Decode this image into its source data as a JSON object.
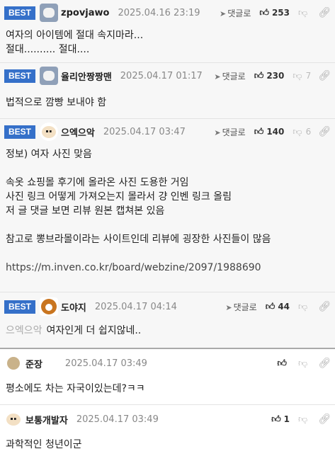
{
  "comments": [
    {
      "best": "BEST",
      "nick": "zpovjawo",
      "date": "2025.04.16 23:19",
      "reply": "댓글로",
      "up": "253",
      "down": "",
      "lines": [
        "여자의 아이템에 절대 속지마라...",
        "절대.......... 절대...."
      ]
    },
    {
      "best": "BEST",
      "nick": "율리안짱짱맨",
      "date": "2025.04.17 01:17",
      "reply": "댓글로",
      "up": "230",
      "down": "7",
      "lines": [
        "법적으로 깜빵 보내야 함"
      ]
    },
    {
      "best": "BEST",
      "nick": "으엑으악",
      "date": "2025.04.17 03:47",
      "reply": "댓글로",
      "up": "140",
      "down": "6",
      "lines": [
        "정보) 여자 사진 맞음",
        "",
        "속옷 쇼핑몰 후기에 올라온 사진 도용한 거임",
        "사진 링크 어떻게 가져오는지 몰라서 걍 인벤 링크 올림",
        "저 글 댓글 보면 리뷰 원본 캡쳐본 있음",
        "",
        "참고로 뽕브라몰이라는 사이트인데 리뷰에 굉장한 사진들이 많음",
        "",
        "https://m.inven.co.kr/board/webzine/2097/1988690"
      ]
    },
    {
      "best": "BEST",
      "nick": "도야지",
      "date": "2025.04.17 04:14",
      "reply": "댓글로",
      "up": "44",
      "down": "",
      "mention": "으엑으악",
      "lines": [
        "여자인게 더 쉽지않네.."
      ]
    },
    {
      "nick": "준장",
      "date": "2025.04.17 03:49",
      "up": "",
      "lines": [
        "평소에도 차는 자국이있는데?ㅋㅋ"
      ]
    },
    {
      "nick": "보통개발자",
      "date": "2025.04.17 03:49",
      "up": "1",
      "lines": [
        "과학적인 청년이군"
      ]
    }
  ],
  "icons": {
    "reply": "paper-plane-icon",
    "up": "thumbs-up-icon",
    "down": "thumbs-down-icon",
    "link": "link-icon"
  },
  "colors": {
    "best_badge": "#3570c9",
    "best_bg": "#f7f7f7"
  }
}
